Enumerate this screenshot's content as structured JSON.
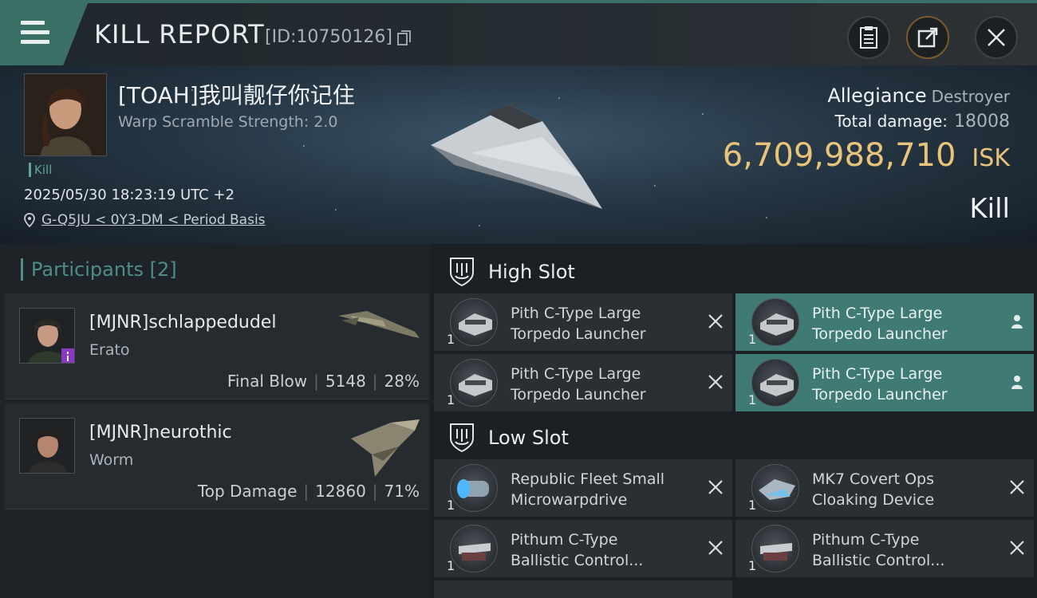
{
  "header": {
    "title": "KILL REPORT",
    "report_id": "[ID:10750126]"
  },
  "victim": {
    "name": "[TOAH]我叫靓仔你记住",
    "warp_scramble": "Warp Scramble Strength: 2.0",
    "tag": "Kill",
    "datetime": "2025/05/30 18:23:19 UTC +2",
    "location": "G-Q5JU < 0Y3-DM < Period Basis"
  },
  "summary": {
    "allegiance_label": "Allegiance",
    "ship_class": "Destroyer",
    "total_damage_label": "Total damage:",
    "total_damage": "18008",
    "isk_value": "6,709,988,710",
    "isk_unit": "ISK",
    "result": "Kill"
  },
  "participants": {
    "header": "Participants [2]",
    "items": [
      {
        "name": "[MJNR]schlappedudel",
        "ship": "Erato",
        "role": "Final Blow",
        "damage": "5148",
        "percent": "28%"
      },
      {
        "name": "[MJNR]neurothic",
        "ship": "Worm",
        "role": "Top Damage",
        "damage": "12860",
        "percent": "71%"
      }
    ]
  },
  "slots": {
    "high_label": "High Slot",
    "low_label": "Low Slot",
    "high": [
      {
        "qty": "1",
        "line1": "Pith C-Type Large",
        "line2": "Torpedo Launcher",
        "state": "destroyed"
      },
      {
        "qty": "1",
        "line1": "Pith C-Type Large",
        "line2": "Torpedo Launcher",
        "state": "dropped"
      },
      {
        "qty": "1",
        "line1": "Pith C-Type Large",
        "line2": "Torpedo Launcher",
        "state": "destroyed"
      },
      {
        "qty": "1",
        "line1": "Pith C-Type Large",
        "line2": "Torpedo Launcher",
        "state": "dropped"
      }
    ],
    "low": [
      {
        "qty": "1",
        "line1": "Republic Fleet Small",
        "line2": "Microwarpdrive",
        "state": "destroyed"
      },
      {
        "qty": "1",
        "line1": "MK7 Covert Ops",
        "line2": "Cloaking Device",
        "state": "destroyed"
      },
      {
        "qty": "1",
        "line1": "Pithum C-Type",
        "line2": "Ballistic Control...",
        "state": "destroyed"
      },
      {
        "qty": "1",
        "line1": "Pithum C-Type",
        "line2": "Ballistic Control...",
        "state": "destroyed"
      }
    ]
  },
  "colors": {
    "accent": "#3b7067",
    "isk": "#e8c37a",
    "highlight_row": "#3f7a74"
  }
}
